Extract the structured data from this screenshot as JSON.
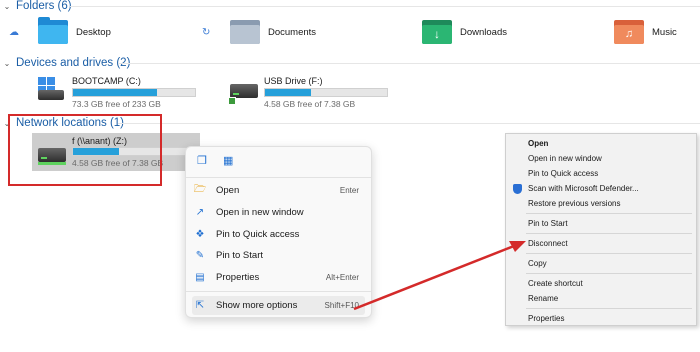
{
  "sections": {
    "folders": "Folders (6)",
    "devices": "Devices and drives (2)",
    "network": "Network locations (1)"
  },
  "folders": [
    {
      "name": "Desktop",
      "icon": "desktop-folder-icon"
    },
    {
      "name": "Documents",
      "icon": "documents-folder-icon"
    },
    {
      "name": "Downloads",
      "icon": "downloads-folder-icon"
    },
    {
      "name": "Music",
      "icon": "music-folder-icon"
    }
  ],
  "drives": [
    {
      "name": "BOOTCAMP (C:)",
      "free": "73.3 GB free of 233 GB",
      "used_fraction": 0.69,
      "icon": "windows-drive-icon"
    },
    {
      "name": "USB Drive (F:)",
      "free": "4.58 GB free of 7.38 GB",
      "used_fraction": 0.38,
      "icon": "usb-drive-icon"
    }
  ],
  "network": {
    "name": "f (\\\\anant) (Z:)",
    "free": "4.58 GB free of 7.38 GB",
    "used_fraction": 0.38,
    "icon": "network-drive-icon"
  },
  "context_menu": {
    "top_icons": [
      "copy-icon",
      "rename-icon"
    ],
    "items": [
      {
        "label": "Open",
        "shortcut": "Enter",
        "icon": "folder-open-icon"
      },
      {
        "label": "Open in new window",
        "shortcut": "",
        "icon": "new-window-icon"
      },
      {
        "label": "Pin to Quick access",
        "shortcut": "",
        "icon": "pin-icon"
      },
      {
        "label": "Pin to Start",
        "shortcut": "",
        "icon": "pin-start-icon"
      },
      {
        "label": "Properties",
        "shortcut": "Alt+Enter",
        "icon": "properties-icon"
      },
      {
        "label": "Show more options",
        "shortcut": "Shift+F10",
        "icon": "more-options-icon"
      }
    ]
  },
  "classic_menu": {
    "items": [
      "Open",
      "Open in new window",
      "Pin to Quick access",
      "Scan with Microsoft Defender...",
      "Restore previous versions",
      "Pin to Start",
      "Disconnect",
      "Copy",
      "Create shortcut",
      "Rename",
      "Properties"
    ]
  },
  "colors": {
    "annotation": "#d42a2a",
    "drive_bar": "#26a0da",
    "section_header": "#1b5ea6"
  }
}
